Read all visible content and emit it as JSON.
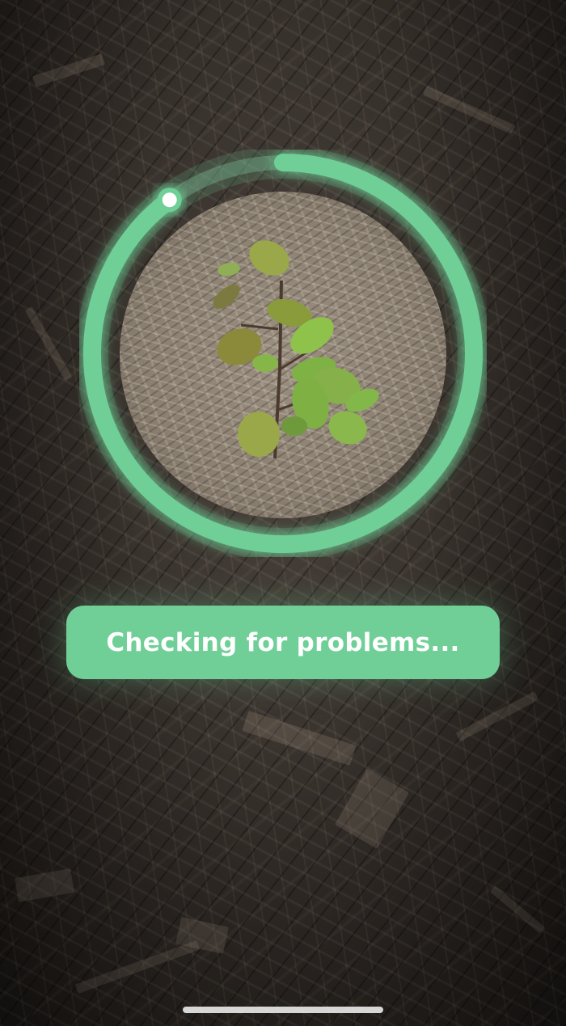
{
  "screen": {
    "name": "plant-diagnosis-scanning"
  },
  "scanner": {
    "progress_icon": "progress-ring-icon",
    "progress_color": "#6fcf97",
    "photo_subject": "plant-photo-icon"
  },
  "status": {
    "label": "Checking for problems..."
  },
  "colors": {
    "accent": "#6fcf97",
    "text": "#ffffff"
  }
}
